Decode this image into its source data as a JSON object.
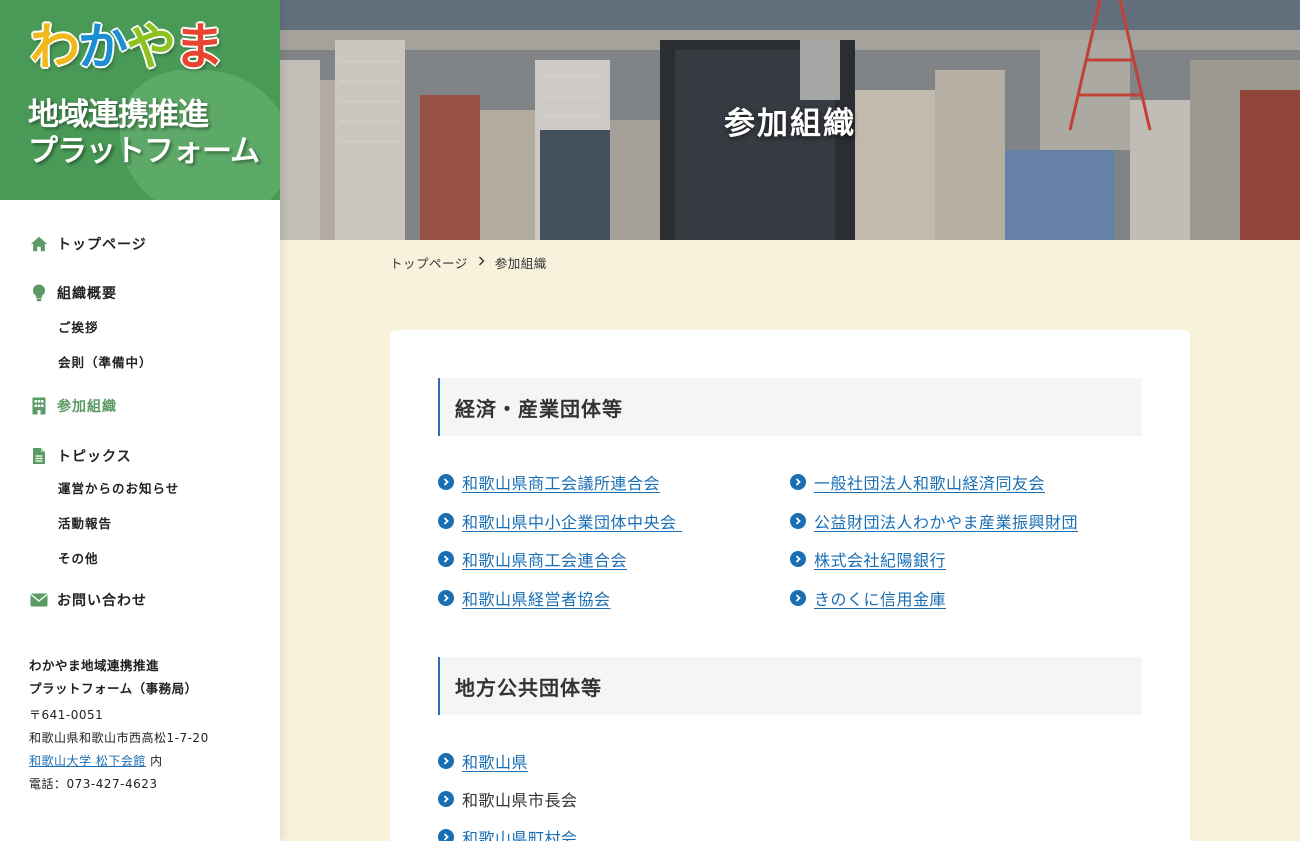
{
  "logo": {
    "chars": [
      "わ",
      "か",
      "や",
      "ま"
    ],
    "line1": "地域連携推進",
    "line2": "プラットフォーム"
  },
  "nav": {
    "top": "トップページ",
    "overview": "組織概要",
    "overview_sub": [
      "ご挨拶",
      "会則（準備中）"
    ],
    "members": "参加組織",
    "topics": "トピックス",
    "topics_sub": [
      "運営からのお知らせ",
      "活動報告",
      "その他"
    ],
    "contact": "お問い合わせ"
  },
  "address": {
    "org1": "わかやま地域連携推進",
    "org2": "プラットフォーム（事務局）",
    "zip": "〒641-0051",
    "addr": "和歌山県和歌山市西高松1-7-20",
    "building_link": "和歌山大学 松下会館",
    "building_suffix": " 内",
    "tel": "電話：073-427-4623"
  },
  "hero": {
    "title": "参加組織"
  },
  "breadcrumb": {
    "home": "トップページ",
    "current": "参加組織"
  },
  "sections": [
    {
      "title": "経済・産業団体等",
      "left": [
        "和歌山県商工会議所連合会",
        "和歌山県中小企業団体中央会 ",
        "和歌山県商工会連合会",
        "和歌山県経営者協会"
      ],
      "right": [
        "一般社団法人和歌山経済同友会",
        "公益財団法人わかやま産業振興財団",
        "株式会社紀陽銀行",
        "きのくに信用金庫"
      ]
    },
    {
      "title": "地方公共団体等",
      "items": [
        "和歌山県",
        "和歌山県市長会",
        "和歌山県町村会"
      ]
    }
  ],
  "colors": {
    "brand_green": "#4a9a57",
    "link_blue": "#1a6eb4",
    "page_bg": "#f8f1dc"
  }
}
